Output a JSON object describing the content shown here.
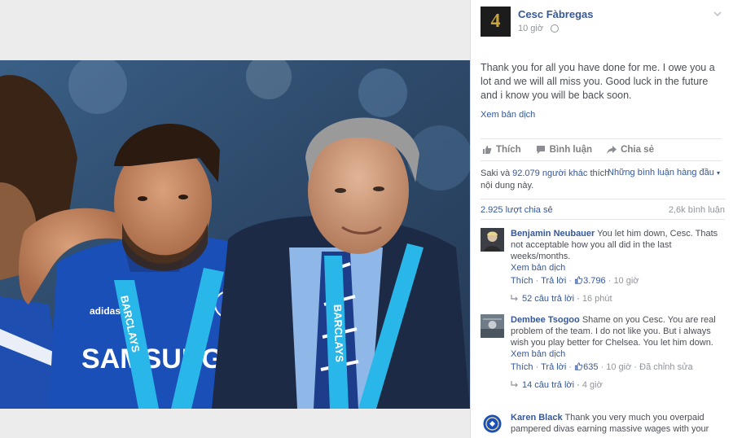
{
  "post": {
    "page_name": "Cesc Fàbregas",
    "time": "10 giờ",
    "text": "Thank you for all you have done for me. I owe you a lot and we will all miss you. Good luck in the future and i know you will be back soon.",
    "translate": "Xem bản dịch",
    "avatar_glyph": "4"
  },
  "actions": {
    "like": "Thích",
    "comment": "Bình luận",
    "share": "Chia sẻ"
  },
  "engagement": {
    "likes_prefix": "Saki và",
    "likes_link": "92.079 người khác",
    "likes_suffix": "thích nội dung này.",
    "sort_label": "Những bình luận hàng đầu",
    "shares": "2.925 lượt chia sẻ",
    "comments": "2,6k bình luận"
  },
  "comments": [
    {
      "author": "Benjamin Neubauer",
      "text": "You let him down, Cesc. Thats not acceptable how you all did in the last weeks/months.",
      "translate": "Xem bản dịch",
      "like": "Thích",
      "reply": "Trả lời",
      "likes": "3.796",
      "time": "10 giờ",
      "replies": "52 câu trả lời",
      "replies_time": "16 phút"
    },
    {
      "author": "Dembee Tsogoo",
      "text": "Shame on you Cesc. You are real problem of the team. I do not like you. But i always wish you play better for Chelsea. You let him down.",
      "translate": "Xem bản dịch",
      "like": "Thích",
      "reply": "Trả lời",
      "likes": "635",
      "time": "10 giờ",
      "edited": "Đã chỉnh sửa",
      "replies": "14 câu trả lời",
      "replies_time": "4 giờ"
    },
    {
      "author": "Karen Black",
      "text": "Thank you very much you overpaid pampered divas earning massive wages with your"
    }
  ],
  "photo": {
    "shirt_text": "SAMSUNG",
    "lanyard_text": "BARCLAYS",
    "brand": "adidas"
  },
  "colors": {
    "link": "#365899",
    "secondary": "#90949c",
    "chelsea_blue": "#1b4fb8",
    "lanyard": "#29b6e8"
  }
}
